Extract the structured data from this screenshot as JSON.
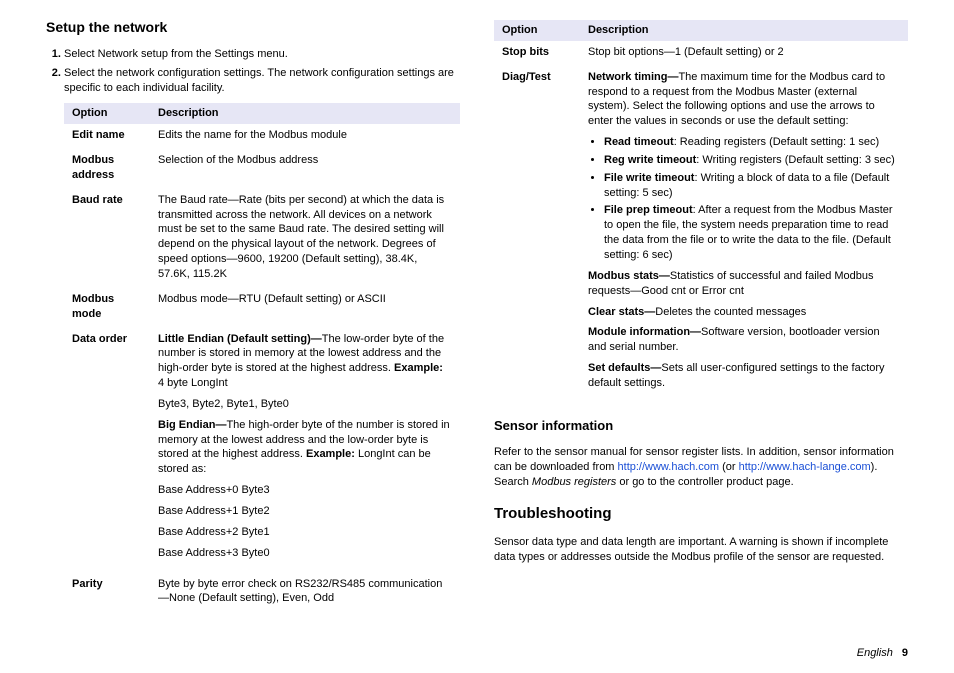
{
  "left": {
    "heading": "Setup the network",
    "steps": [
      "Select Network setup from the Settings menu.",
      "Select the network configuration settings. The network configuration settings are specific to each individual facility."
    ],
    "table": {
      "headers": [
        "Option",
        "Description"
      ],
      "rows": [
        {
          "option": "Edit name",
          "desc_plain": "Edits the name for the Modbus module"
        },
        {
          "option": "Modbus address",
          "desc_plain": "Selection of the Modbus address"
        },
        {
          "option": "Baud rate",
          "desc_plain": "The Baud rate—Rate (bits per second) at which the data is transmitted across the network. All devices on a network must be set to the same Baud rate. The desired setting will depend on the physical layout of the network. Degrees of speed options—9600, 19200 (Default setting), 38.4K, 57.6K, 115.2K"
        },
        {
          "option": "Modbus mode",
          "desc_plain": "Modbus mode—RTU (Default setting) or ASCII"
        },
        {
          "option": "Data order",
          "data_order": {
            "little_b": "Little Endian (Default setting)—",
            "little_t": "The low-order byte of the number is stored in memory at the lowest address and the high-order byte is stored at the highest address. ",
            "example_label": "Example:",
            "little_ex_intro": " 4 byte LongInt",
            "little_ex_line": "Byte3, Byte2, Byte1, Byte0",
            "big_b": "Big Endian—",
            "big_t": "The high-order byte of the number is stored in memory at the lowest address and the low-order byte is stored at the highest address. ",
            "big_ex_intro": " LongInt can be stored as:",
            "big_lines": [
              "Base Address+0 Byte3",
              "Base Address+1 Byte2",
              "Base Address+2 Byte1",
              "Base Address+3 Byte0"
            ]
          }
        },
        {
          "option": "Parity",
          "desc_plain": "Byte by byte error check on RS232/RS485 communication—None (Default setting), Even, Odd"
        }
      ]
    }
  },
  "right": {
    "table": {
      "headers": [
        "Option",
        "Description"
      ],
      "rows": [
        {
          "option": "Stop bits",
          "desc_plain": "Stop bit options—1 (Default setting) or 2"
        },
        {
          "option": "Diag/Test",
          "diag": {
            "nt_b": "Network timing—",
            "nt_t": "The maximum time for the Modbus card to respond to a request from the Modbus Master (external system). Select the following options and use the arrows to enter the values in seconds or use the default setting:",
            "bullets": [
              {
                "b": "Read timeout",
                "t": ": Reading registers (Default setting: 1 sec)"
              },
              {
                "b": "Reg write timeout",
                "t": ": Writing registers (Default setting: 3 sec)"
              },
              {
                "b": "File write timeout",
                "t": ": Writing a block of data to a file (Default setting: 5 sec)"
              },
              {
                "b": "File prep timeout",
                "t": ": After a request from the Modbus Master to open the file, the system needs preparation time to read the data from the file or to write the data to the file. (Default setting: 6 sec)"
              }
            ],
            "ms_b": "Modbus stats—",
            "ms_t": "Statistics of successful and failed Modbus requests—Good cnt or Error cnt",
            "cs_b": "Clear stats—",
            "cs_t": "Deletes the counted messages",
            "mi_b": "Module information—",
            "mi_t": "Software version, bootloader version and serial number.",
            "sd_b": "Set defaults—",
            "sd_t": "Sets all user-configured settings to the factory default settings."
          }
        }
      ]
    },
    "sensor_heading": "Sensor information",
    "sensor_p1a": "Refer to the sensor manual for sensor register lists. In addition, sensor information can be downloaded from ",
    "sensor_link1": "http://www.hach.com",
    "sensor_p1b": " (or ",
    "sensor_link2": "http://www.hach-lange.com",
    "sensor_p1c": "). Search ",
    "sensor_italic": "Modbus registers",
    "sensor_p1d": " or go to the controller product page.",
    "trouble_heading": "Troubleshooting",
    "trouble_p": "Sensor data type and data length are important. A warning is shown if incomplete data types or addresses outside the Modbus profile of the sensor are requested."
  },
  "footer": {
    "lang": "English",
    "page": "9"
  }
}
